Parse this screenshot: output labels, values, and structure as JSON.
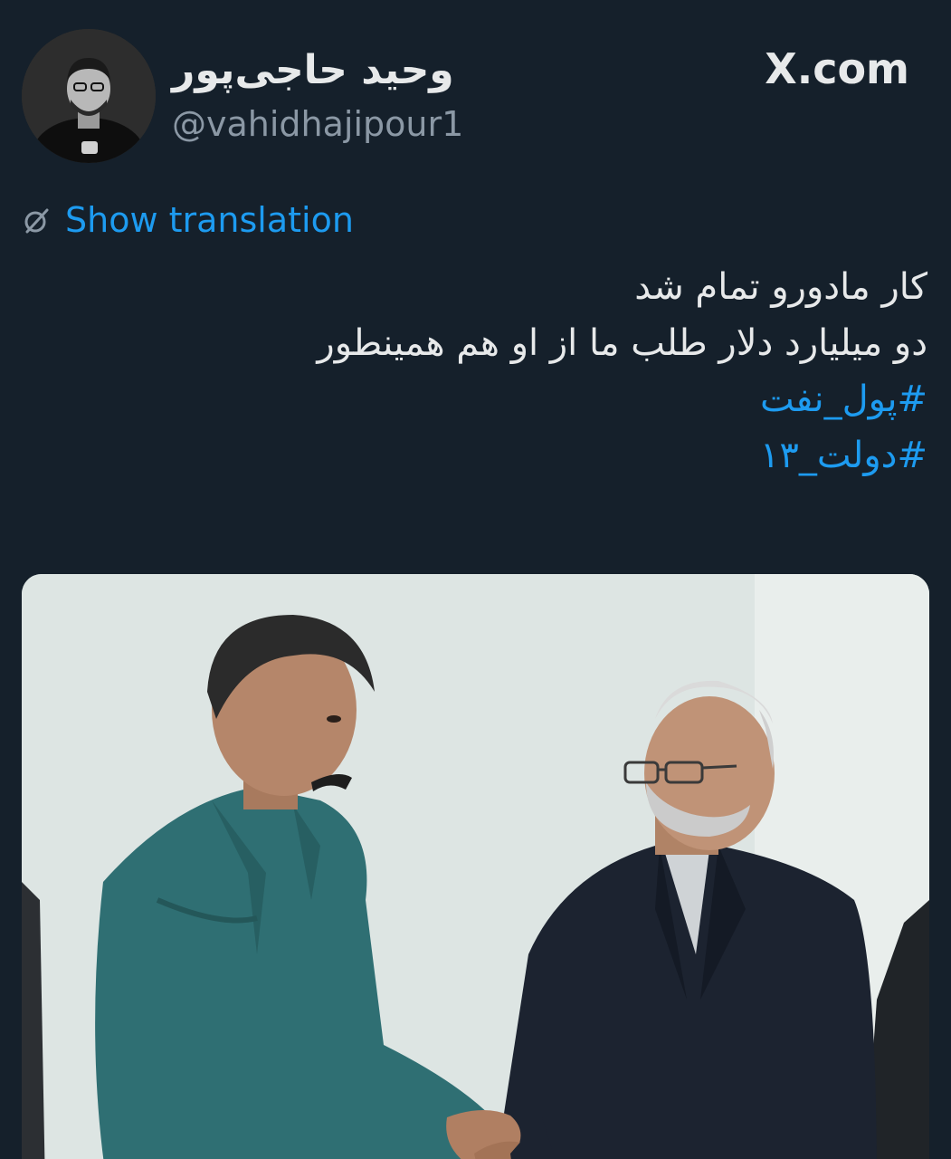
{
  "author": {
    "display_name": "وحید حاجی‌پور",
    "handle": "@vahidhajipour1",
    "avatar_icon": "profile-photo"
  },
  "brand": {
    "label": "X.com"
  },
  "translation": {
    "label": "Show translation",
    "icon": "translate-icon"
  },
  "tweet": {
    "lines": [
      "کار مادورو تمام شد",
      "دو میلیارد دلار طلب ما از او هم همینطور"
    ],
    "hashtags": [
      "#پول_نفت",
      "#دولت_۱۳"
    ]
  },
  "media": {
    "type": "photo",
    "description_icon": "photo-handshake"
  },
  "colors": {
    "background": "#15202b",
    "text_primary": "#e7e9ea",
    "text_secondary": "#8b98a5",
    "link": "#1d9bf0"
  }
}
